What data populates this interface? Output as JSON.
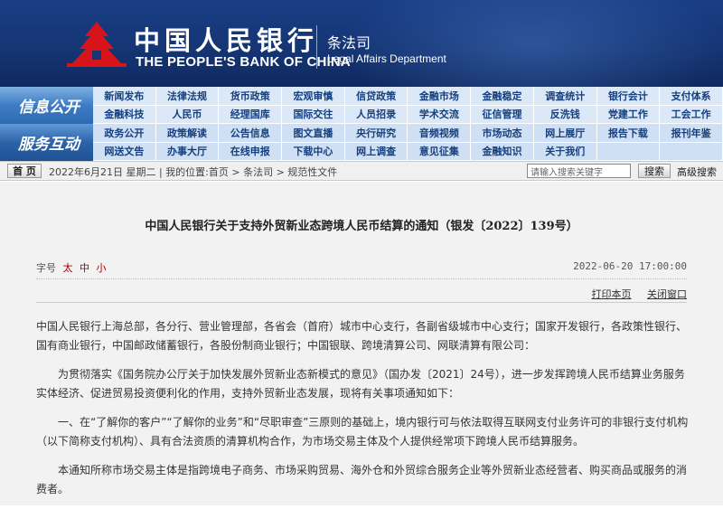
{
  "header": {
    "bank_name_cn": "中国人民银行",
    "bank_name_en": "THE PEOPLE'S BANK OF CHINA",
    "dept_cn": "条法司",
    "dept_en": "Legal Affairs Department",
    "colors": {
      "background": "#153574",
      "logo": "#d8141b"
    }
  },
  "nav": {
    "section_labels": [
      "信息公开",
      "服务互动"
    ],
    "items": [
      "新闻发布",
      "法律法规",
      "货币政策",
      "宏观审慎",
      "信贷政策",
      "金融市场",
      "金融稳定",
      "调查统计",
      "银行会计",
      "支付体系",
      "金融科技",
      "人民币",
      "经理国库",
      "国际交往",
      "人员招录",
      "学术交流",
      "征信管理",
      "反洗钱",
      "党建工作",
      "工会工作",
      "政务公开",
      "政策解读",
      "公告信息",
      "图文直播",
      "央行研究",
      "音频视频",
      "市场动态",
      "网上展厅",
      "报告下载",
      "报刊年鉴",
      "网送文告",
      "办事大厅",
      "在线申报",
      "下载中心",
      "网上调查",
      "意见征集",
      "金融知识",
      "关于我们",
      "",
      ""
    ]
  },
  "breadcrumb": {
    "home_label": "首 页",
    "text": "2022年6月21日 星期二 | 我的位置:首页 > 条法司 > 规范性文件",
    "search_placeholder": "请输入搜索关键字",
    "search_button": "搜索",
    "advanced_search": "高级搜索"
  },
  "article": {
    "title": "中国人民银行关于支持外贸新业态跨境人民币结算的通知（银发〔2022〕139号）",
    "font_size_label": "字号",
    "font_size_options": [
      "太",
      "中",
      "小"
    ],
    "date": "2022-06-20 17:00:00",
    "print_label": "打印本页",
    "close_label": "关闭窗口",
    "paragraphs": [
      "中国人民银行上海总部，各分行、营业管理部，各省会（首府）城市中心支行，各副省级城市中心支行；国家开发银行，各政策性银行、国有商业银行，中国邮政储蓄银行，各股份制商业银行；中国银联、跨境清算公司、网联清算有限公司：",
      "为贯彻落实《国务院办公厅关于加快发展外贸新业态新模式的意见》（国办发〔2021〕24号），进一步发挥跨境人民币结算业务服务实体经济、促进贸易投资便利化的作用，支持外贸新业态发展，现将有关事项通知如下：",
      "一、在“了解你的客户”“了解你的业务”和“尽职审查”三原则的基础上，境内银行可与依法取得互联网支付业务许可的非银行支付机构（以下简称支付机构）、具有合法资质的清算机构合作，为市场交易主体及个人提供经常项下跨境人民币结算服务。",
      "本通知所称市场交易主体是指跨境电子商务、市场采购贸易、海外仓和外贸综合服务企业等外贸新业态经营者、购买商品或服务的消费者。"
    ]
  }
}
